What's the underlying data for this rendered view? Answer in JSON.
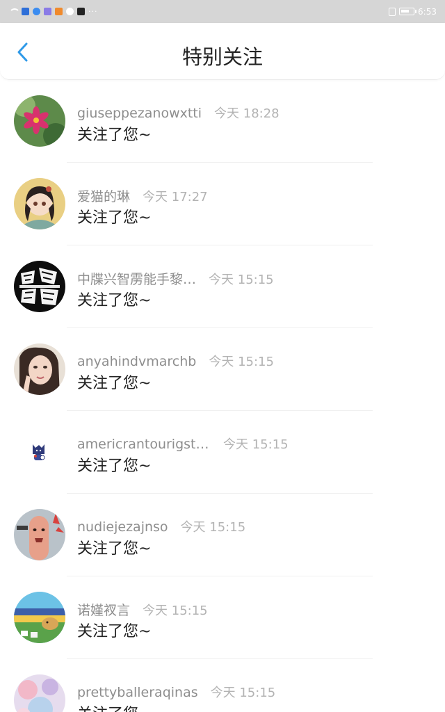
{
  "status_bar": {
    "time": "6:53",
    "icons": [
      "wifi-icon",
      "security-icon",
      "browser-icon",
      "video-icon",
      "cloud-icon",
      "app-icon",
      "more-dots-icon",
      "vibrate-icon",
      "battery-icon"
    ]
  },
  "header": {
    "title": "特别关注",
    "back_icon": "chevron-left-icon",
    "accent_color": "#2f9ae8"
  },
  "list": {
    "items": [
      {
        "name": "giuseppezanowxtti",
        "time": "今天 18:28",
        "message": "关注了您~",
        "avatar": "flower"
      },
      {
        "name": "爱猫的琳",
        "time": "今天 17:27",
        "message": "关注了您~",
        "avatar": "anime-girl"
      },
      {
        "name": "中牒兴智雳能手黎…",
        "time": "今天 15:15",
        "message": "关注了您~",
        "avatar": "calligraphy"
      },
      {
        "name": "anyahindvmarchb",
        "time": "今天 15:15",
        "message": "关注了您~",
        "avatar": "selfie"
      },
      {
        "name": "americrantourigstt…",
        "time": "今天 15:15",
        "message": "关注了您~",
        "avatar": "cartoon-cat"
      },
      {
        "name": "nudiejezajnso",
        "time": "今天 15:15",
        "message": "关注了您~",
        "avatar": "finger-face"
      },
      {
        "name": "诺嫤衩言",
        "time": "今天 15:15",
        "message": "关注了您~",
        "avatar": "game-scene"
      },
      {
        "name": "prettyballeraqinas",
        "time": "今天 15:15",
        "message": "关注了您~",
        "avatar": "pastel"
      }
    ]
  }
}
